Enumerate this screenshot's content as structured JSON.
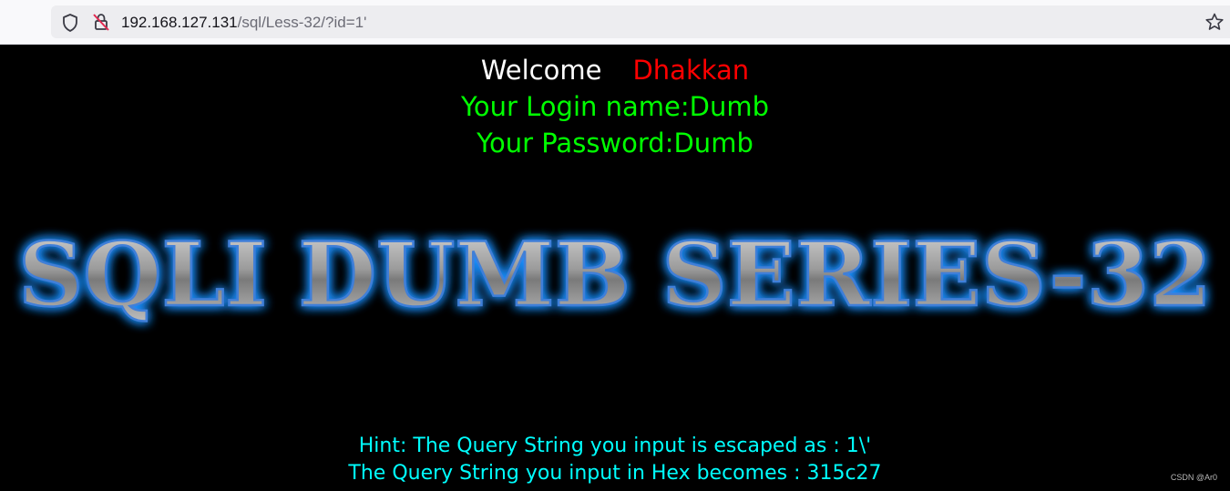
{
  "browser": {
    "url_host": "192.168.127.131",
    "url_path": "/sql/Less-32/?id=1'",
    "icons": [
      "shield-icon",
      "insecure-lock-icon",
      "bookmark-star-icon"
    ]
  },
  "page": {
    "welcome_word": "Welcome",
    "welcome_name": "Dhakkan",
    "login_line": "Your Login name:Dumb",
    "password_line": "Your Password:Dumb",
    "banner_text": "SQLI DUMB SERIES-32",
    "hint_line_1": "Hint: The Query String you input is escaped as : 1\\'",
    "hint_line_2": "The Query String you input in Hex becomes : 315c27",
    "watermark": "CSDN @Ar0"
  },
  "colors": {
    "background": "#000000",
    "welcome_word": "#ffffff",
    "welcome_name": "#ff0000",
    "credentials": "#00ff00",
    "hint": "#00ffff",
    "banner_glow": "#1e90ff"
  }
}
